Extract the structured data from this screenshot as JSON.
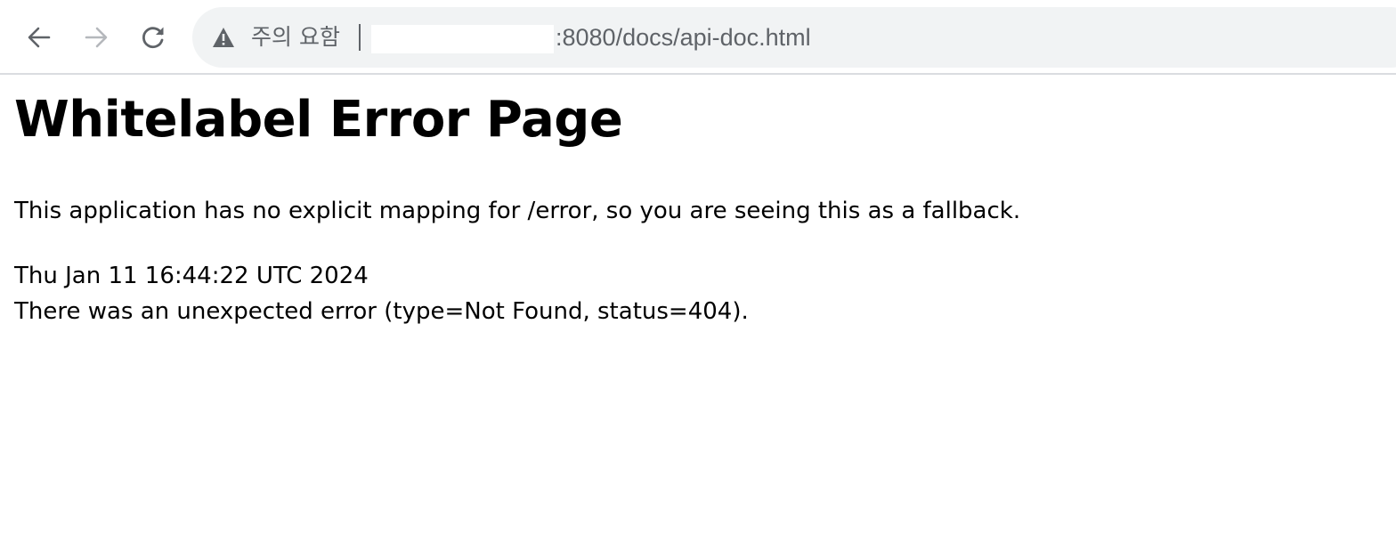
{
  "browser": {
    "security_label": "주의 요함",
    "url_suffix": ":8080/docs/api-doc.html",
    "icons": {
      "back": "arrow-left-icon",
      "forward": "arrow-right-icon",
      "reload": "reload-icon",
      "security": "warning-triangle-icon"
    }
  },
  "page": {
    "title": "Whitelabel Error Page",
    "message": "This application has no explicit mapping for /error, so you are seeing this as a fallback.",
    "timestamp": "Thu Jan 11 16:44:22 UTC 2024",
    "error": "There was an unexpected error (type=Not Found, status=404)."
  }
}
